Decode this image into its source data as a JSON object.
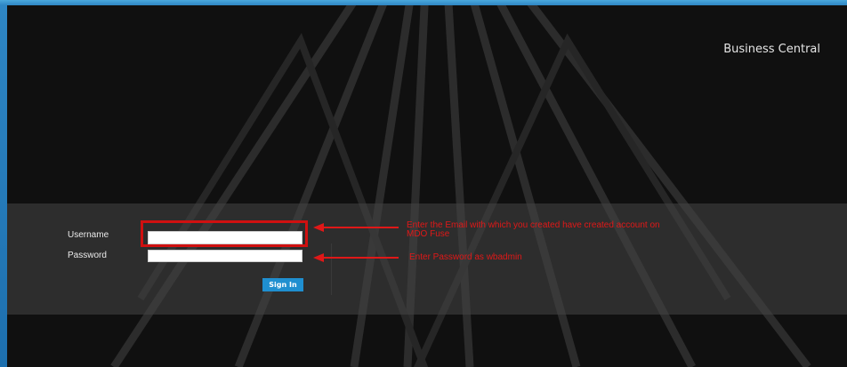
{
  "header": {
    "brand_label": "Business Central"
  },
  "login": {
    "username_label": "Username",
    "password_label": "Password",
    "username_value": "",
    "password_value": "",
    "sign_in_label": "Sign In"
  },
  "annotations": {
    "username_note": "Enter the Email with which you created have created account on MDO Fuse",
    "password_note": "Enter Password as wbadmin"
  },
  "colors": {
    "background": "#101010",
    "band": "#464646",
    "button": "#1f8fd0",
    "annotation": "#e01818",
    "frame": "#2e86c4"
  }
}
